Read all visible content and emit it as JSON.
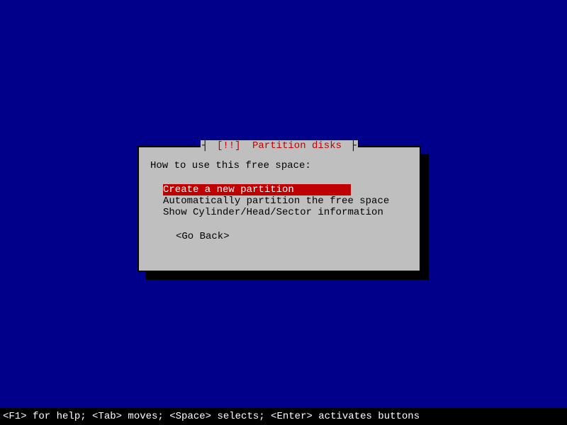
{
  "dialog": {
    "title_bracket_open": "┤ ",
    "title_bracket_close": " ├",
    "title_marker": "[!!]",
    "title_text": "Partition disks",
    "prompt": "How to use this free space:",
    "options": [
      "Create a new partition",
      "Automatically partition the free space",
      "Show Cylinder/Head/Sector information"
    ],
    "selected_index": 0,
    "go_back": "<Go Back>"
  },
  "status_bar": "<F1> for help; <Tab> moves; <Space> selects; <Enter> activates buttons"
}
